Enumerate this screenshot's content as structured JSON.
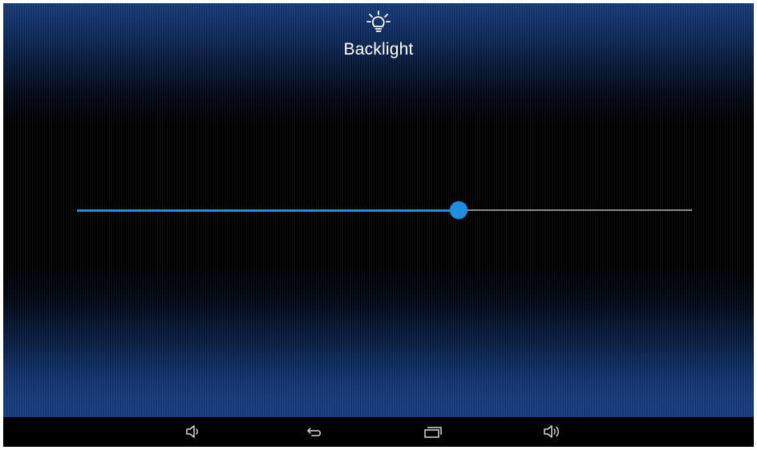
{
  "header": {
    "icon": "lightbulb-icon",
    "title": "Backlight"
  },
  "backlight_slider": {
    "level_percent": 62,
    "active_color": "#1e8fe0",
    "inactive_color": "#8a8a8a"
  },
  "navbar": {
    "buttons": [
      {
        "name": "volume-down-button",
        "icon": "volume-down-icon"
      },
      {
        "name": "back-button",
        "icon": "back-icon"
      },
      {
        "name": "recent-apps-button",
        "icon": "recent-apps-icon"
      },
      {
        "name": "volume-up-button",
        "icon": "volume-up-icon"
      }
    ]
  },
  "colors": {
    "background_top": "#173b7b",
    "background_middle": "#000000",
    "navbar": "#000000",
    "accent": "#1e8fe0"
  }
}
